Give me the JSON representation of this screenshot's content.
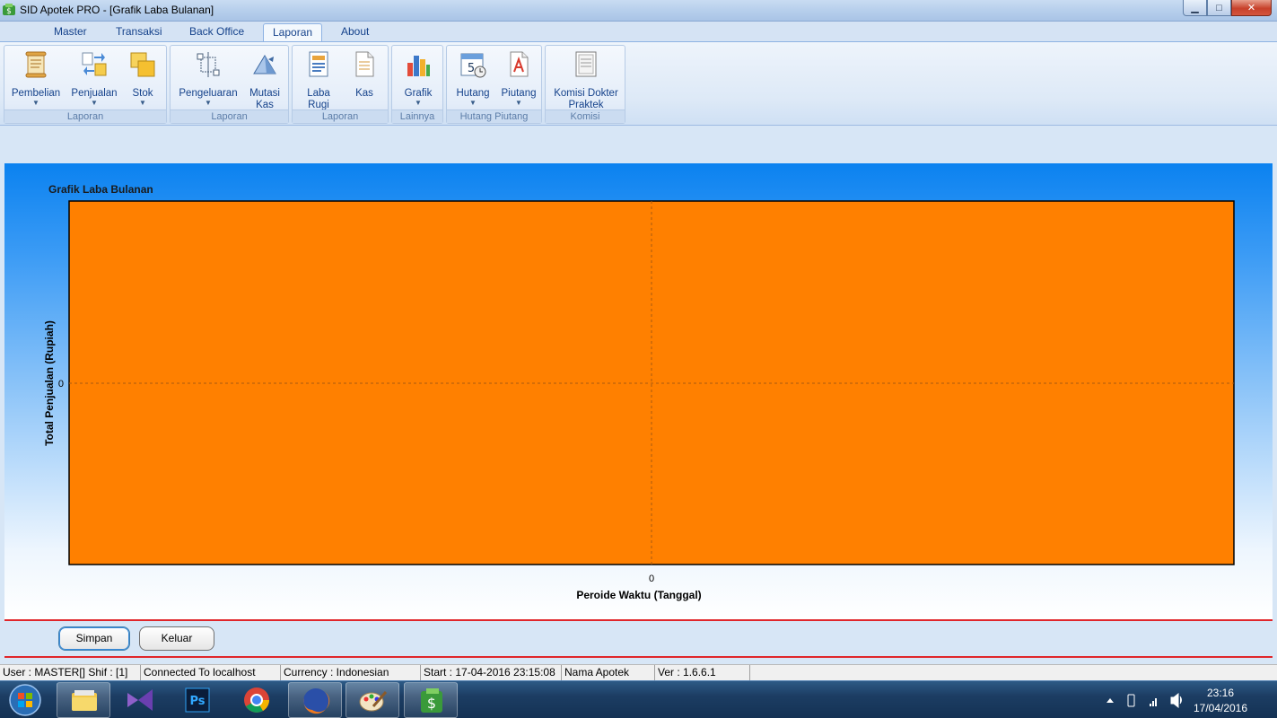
{
  "window": {
    "title": "SID Apotek PRO - [Grafik Laba Bulanan]",
    "minimize_glyph": "▁",
    "maximize_glyph": "□",
    "close_glyph": "✕"
  },
  "menu_tabs": [
    {
      "label": "Master",
      "active": false
    },
    {
      "label": "Transaksi",
      "active": false
    },
    {
      "label": "Back Office",
      "active": false
    },
    {
      "label": "Laporan",
      "active": true
    },
    {
      "label": "About",
      "active": false
    }
  ],
  "ribbon": {
    "groups": [
      {
        "label": "Laporan",
        "buttons": [
          {
            "label": "Pembelian",
            "icon": "scroll-icon",
            "dropdown": true
          },
          {
            "label": "Penjualan",
            "icon": "transfer-icon",
            "dropdown": true
          },
          {
            "label": "Stok",
            "icon": "stack-icon",
            "dropdown": true
          }
        ]
      },
      {
        "label": "Laporan",
        "buttons": [
          {
            "label": "Pengeluaran",
            "icon": "crop-icon",
            "dropdown": true
          },
          {
            "label": "Mutasi Kas",
            "icon": "triangle-icon",
            "dropdown": false
          }
        ]
      },
      {
        "label": "Laporan",
        "buttons": [
          {
            "label": "Laba Rugi",
            "icon": "report-icon",
            "dropdown": false
          },
          {
            "label": "Kas",
            "icon": "document-icon",
            "dropdown": false
          }
        ]
      },
      {
        "label": "Lainnya",
        "buttons": [
          {
            "label": "Grafik",
            "icon": "bar-chart-icon",
            "dropdown": true
          }
        ]
      },
      {
        "label": "Hutang Piutang",
        "buttons": [
          {
            "label": "Hutang",
            "icon": "calendar-icon",
            "dropdown": true
          },
          {
            "label": "Piutang",
            "icon": "pdf-document-icon",
            "dropdown": true
          }
        ]
      },
      {
        "label": "Komisi",
        "buttons": [
          {
            "label": "Komisi Dokter Praktek",
            "icon": "page-icon",
            "dropdown": false
          }
        ]
      }
    ]
  },
  "chart_data": {
    "type": "bar",
    "title": "Grafik Laba Bulanan",
    "xlabel": "Peroide Waktu (Tanggal)",
    "ylabel": "Total Penjualan (Rupiah)",
    "x_ticks": [
      "0"
    ],
    "y_ticks": [
      "0"
    ],
    "categories": [],
    "values": [],
    "grid": true,
    "plot_background": "#ff8000",
    "panel_background": "#0b82f0"
  },
  "actions": {
    "save_label": "Simpan",
    "exit_label": "Keluar"
  },
  "statusbar": {
    "user": "User : MASTER[] Shif : [1]",
    "connection": "Connected To localhost",
    "currency": "Currency : Indonesian",
    "start": "Start  : 17-04-2016 23:15:08",
    "store": "Nama Apotek",
    "version": "Ver : 1.6.6.1"
  },
  "taskbar": {
    "apps": [
      "explorer-icon",
      "visual-studio-icon",
      "photoshop-icon",
      "chrome-icon",
      "firefox-icon",
      "paint-icon",
      "sid-apotek-icon"
    ],
    "ps_text": "Ps",
    "time": "23:16",
    "date": "17/04/2016"
  },
  "colors": {
    "accent": "#15428b",
    "plot": "#ff8000",
    "divider": "#e0262b"
  }
}
